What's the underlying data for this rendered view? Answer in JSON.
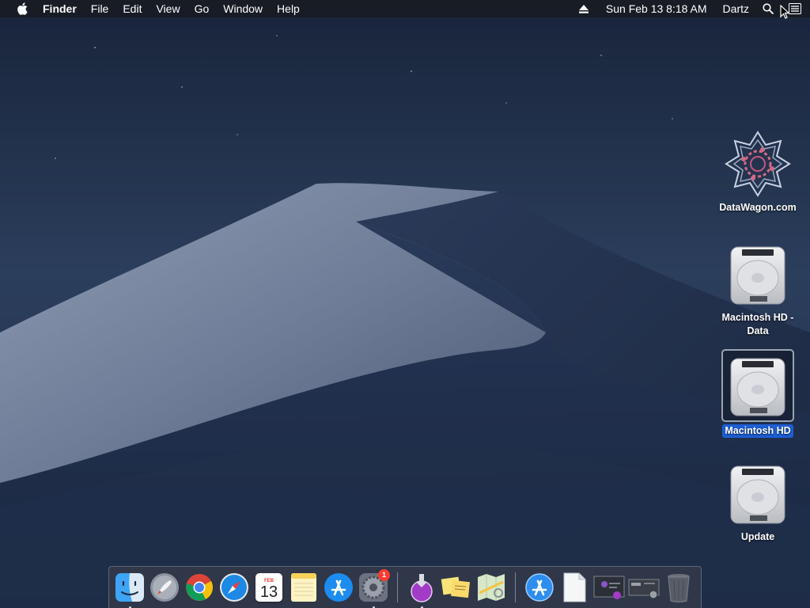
{
  "menubar": {
    "app_name": "Finder",
    "menus": [
      "File",
      "Edit",
      "View",
      "Go",
      "Window",
      "Help"
    ],
    "date_time": "Sun Feb 13  8:18 AM",
    "user": "Dartz",
    "icons": [
      "apple-icon",
      "eject-icon",
      "spotlight-icon",
      "control-center-icon"
    ]
  },
  "desktop": {
    "icons": [
      {
        "label": "DataWagon.com",
        "icon": "datawagon-logo-icon",
        "selected": false
      },
      {
        "label": "Macintosh HD - Data",
        "icon": "hard-drive-icon",
        "selected": false
      },
      {
        "label": "Macintosh HD",
        "icon": "hard-drive-icon",
        "selected": true
      },
      {
        "label": "Update",
        "icon": "hard-drive-icon",
        "selected": false
      }
    ]
  },
  "dock": {
    "apps": [
      {
        "name": "Finder",
        "icon": "finder-icon",
        "running": true
      },
      {
        "name": "Launchpad",
        "icon": "launchpad-icon",
        "running": false
      },
      {
        "name": "Google Chrome",
        "icon": "chrome-icon",
        "running": false
      },
      {
        "name": "Safari",
        "icon": "safari-icon",
        "running": false
      },
      {
        "name": "Calendar",
        "icon": "calendar-icon",
        "running": false,
        "month": "FEB",
        "day": "13"
      },
      {
        "name": "Notes",
        "icon": "notes-icon",
        "running": false
      },
      {
        "name": "App Store",
        "icon": "app-store-icon",
        "running": false
      },
      {
        "name": "System Preferences",
        "icon": "system-preferences-icon",
        "running": true,
        "badge": "1"
      }
    ],
    "middle": [
      {
        "name": "Install macOS",
        "icon": "install-macos-icon",
        "running": true
      },
      {
        "name": "Stickies",
        "icon": "stickies-icon",
        "running": false
      },
      {
        "name": "Maps",
        "icon": "maps-icon",
        "running": false
      }
    ],
    "others": [
      {
        "name": "Applications",
        "icon": "applications-folder-icon"
      },
      {
        "name": "Document",
        "icon": "document-icon"
      },
      {
        "name": "Screenshot 1",
        "icon": "screenshot-thumbnail-icon"
      },
      {
        "name": "Screenshot 2",
        "icon": "screenshot-thumbnail-icon"
      },
      {
        "name": "Trash",
        "icon": "trash-icon"
      }
    ]
  },
  "colors": {
    "selection": "#1d5fd6",
    "badge": "#ff3b30",
    "menubar": "#181c24"
  }
}
